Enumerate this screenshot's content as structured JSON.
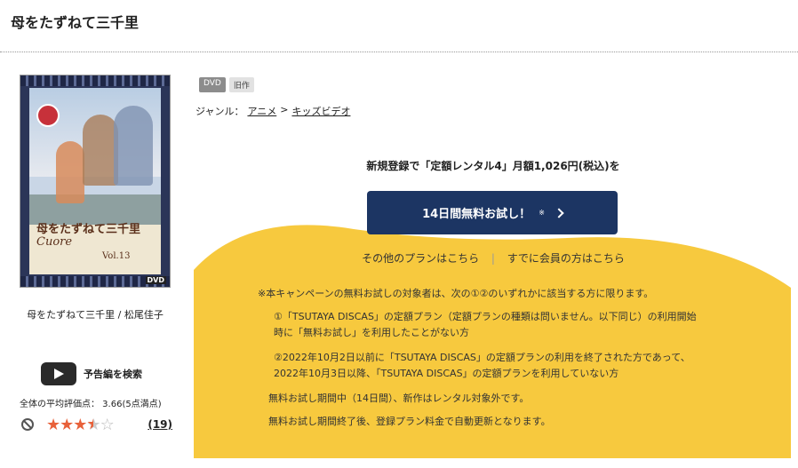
{
  "page": {
    "title": "母をたずねて三千里"
  },
  "product": {
    "jacket": {
      "logo_ja": "母をたずねて三千里",
      "logo_en": "Cuore",
      "volume": "Vol.13",
      "format_mark": "DVD"
    },
    "credit": "母をたずねて三千里 / 松尾佳子",
    "trailer_label": "予告編を検索",
    "rating_text": "全体の平均評価点： 3.66(5点満点)",
    "rating_value": 3.66,
    "rating_max": 5,
    "review_count": "(19)"
  },
  "badges": [
    "DVD",
    "旧作"
  ],
  "genre": {
    "label": "ジャンル：",
    "items": [
      "アニメ",
      "キッズビデオ"
    ],
    "separator": ">"
  },
  "campaign": {
    "headline": "新規登録で「定額レンタル4」月額1,026円(税込)を",
    "cta_label": "14日間無料お試し！",
    "cta_note": "※",
    "other_plans": "その他のプランはこちら",
    "link_separator": "|",
    "member_link": "すでに会員の方はこちら",
    "notes": {
      "lead": "※本キャンペーンの無料お試しの対象者は、次の①②のいずれかに該当する方に限ります。",
      "item1_line1": "①「TSUTAYA DISCAS」の定額プラン（定額プランの種類は問いません。以下同じ）の利用開始",
      "item1_line2": "時に「無料お試し」を利用したことがない方",
      "item2_line1": "②2022年10月2日以前に「TSUTAYA DISCAS」の定額プランの利用を終了された方であって、",
      "item2_line2": "2022年10月3日以降、「TSUTAYA DISCAS」の定額プランを利用していない方",
      "trial_note": "無料お試し期間中（14日間）、新作はレンタル対象外です。",
      "renew_note": "無料お試し期間終了後、登録プラン料金で自動更新となります。"
    }
  },
  "colors": {
    "accent_yellow": "#F7C93E",
    "cta_navy": "#1C3563",
    "star": "#E8613A"
  }
}
